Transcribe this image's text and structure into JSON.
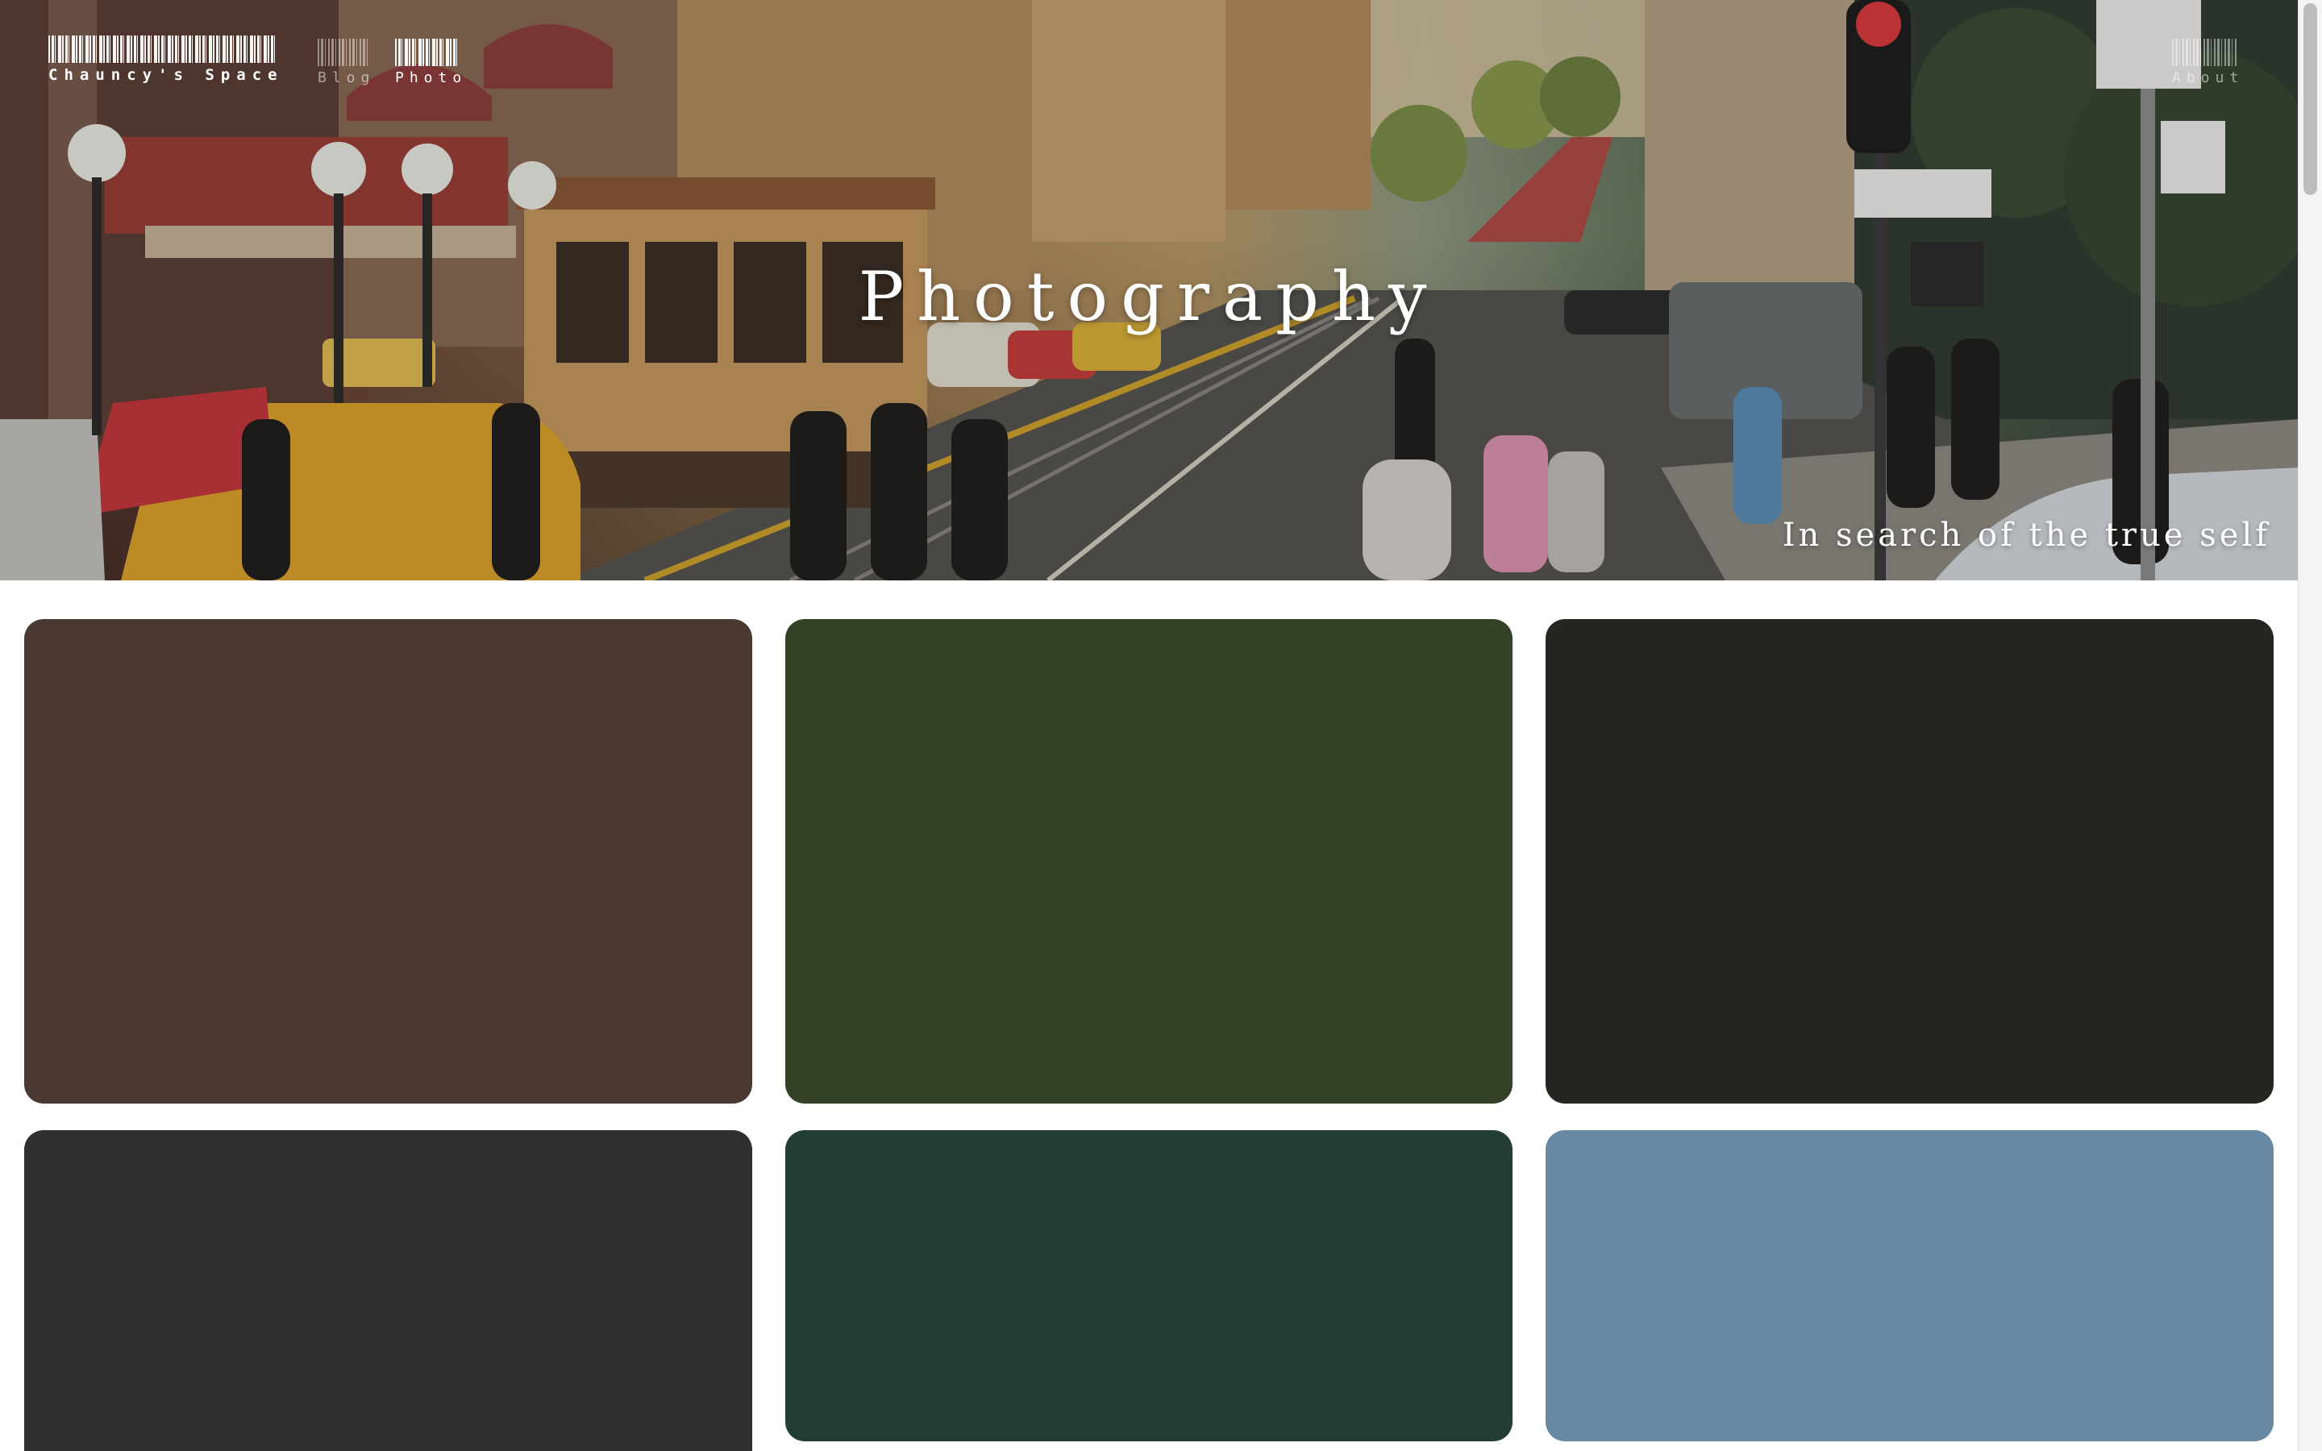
{
  "site": {
    "brand": "Chauncy's Space"
  },
  "nav": {
    "items": [
      {
        "label": "Blog",
        "active": false
      },
      {
        "label": "Photo",
        "active": true
      },
      {
        "label": "About",
        "active": false
      }
    ]
  },
  "hero": {
    "title": "Photography",
    "subtitle": "In search of the true self"
  },
  "gallery": {
    "cards": [
      {
        "color": "#4a3833"
      },
      {
        "color": "#334226"
      },
      {
        "color": "#262521"
      },
      {
        "color": "#303030"
      },
      {
        "color": "#233d32"
      },
      {
        "color": "#6789a3"
      }
    ]
  }
}
